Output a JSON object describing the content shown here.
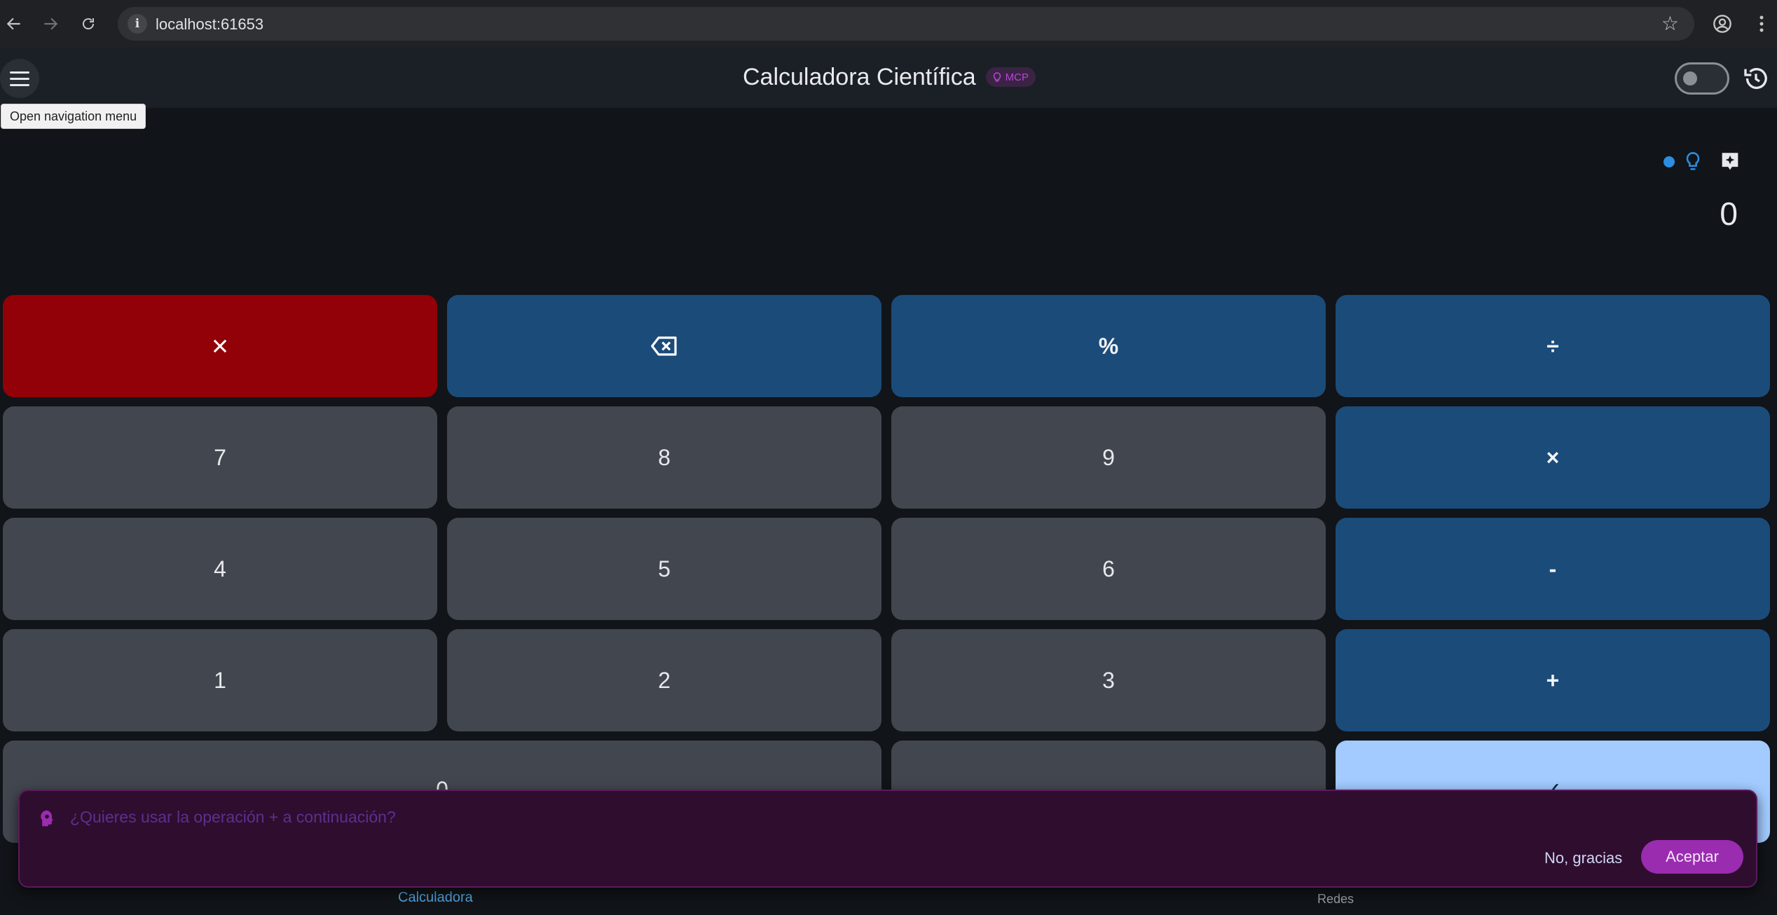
{
  "browser": {
    "url": "localhost:61653",
    "info_glyph": "i"
  },
  "appbar": {
    "title": "Calculadora Científica",
    "badge": "MCP",
    "tooltip": "Open navigation menu"
  },
  "display": {
    "value": "0"
  },
  "keypad": {
    "rows": [
      [
        {
          "label": "✕",
          "kind": "clear"
        },
        {
          "label": "⌫",
          "kind": "op"
        },
        {
          "label": "%",
          "kind": "op"
        },
        {
          "label": "÷",
          "kind": "op"
        }
      ],
      [
        {
          "label": "7",
          "kind": "num"
        },
        {
          "label": "8",
          "kind": "num"
        },
        {
          "label": "9",
          "kind": "num"
        },
        {
          "label": "×",
          "kind": "op"
        }
      ],
      [
        {
          "label": "4",
          "kind": "num"
        },
        {
          "label": "5",
          "kind": "num"
        },
        {
          "label": "6",
          "kind": "num"
        },
        {
          "label": "-",
          "kind": "op"
        }
      ],
      [
        {
          "label": "1",
          "kind": "num"
        },
        {
          "label": "2",
          "kind": "num"
        },
        {
          "label": "3",
          "kind": "num"
        },
        {
          "label": "+",
          "kind": "op"
        }
      ],
      [
        {
          "label": "0",
          "kind": "num"
        },
        {
          "label": ".",
          "kind": "num"
        },
        {
          "label": "✓",
          "kind": "eq"
        }
      ]
    ]
  },
  "snackbar": {
    "message": "¿Quieres usar la operación + a continuación?",
    "dismiss_label": "No, gracias",
    "accept_label": "Aceptar"
  },
  "bottom_nav": {
    "items": [
      {
        "label": "Calculadora",
        "active": true
      },
      {
        "label": "Redes",
        "active": false
      }
    ]
  },
  "colors": {
    "background": "#111418",
    "appbar": "#1b1f26",
    "number_key": "#42464e",
    "operator_key": "#1b4b79",
    "clear_key": "#920008",
    "equals_key": "#a3cbff",
    "snackbar": "#2f0d2f",
    "accent_purple": "#9a2cb0",
    "nav_active": "#4fa3e0"
  }
}
